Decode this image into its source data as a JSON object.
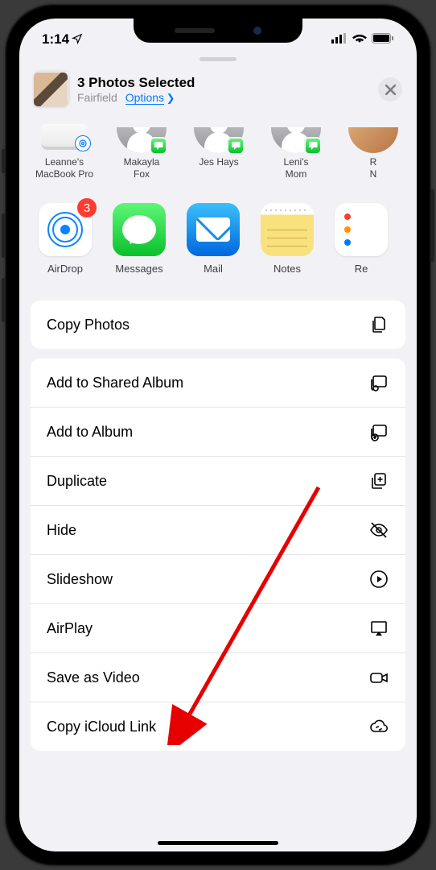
{
  "status": {
    "time": "1:14",
    "location_icon": "location-arrow"
  },
  "header": {
    "title": "3 Photos Selected",
    "location": "Fairfield",
    "options_label": "Options"
  },
  "contacts": [
    {
      "name": "Leanne's\nMacBook Pro",
      "type": "device",
      "badge": "airdrop"
    },
    {
      "name": "Makayla\nFox",
      "type": "person",
      "badge": "messages"
    },
    {
      "name": "Jes Hays",
      "type": "person",
      "badge": "messages"
    },
    {
      "name": "Leni's\nMom",
      "type": "person",
      "badge": "messages"
    },
    {
      "name": "R\nN",
      "type": "person",
      "badge": "none"
    }
  ],
  "apps": [
    {
      "name": "AirDrop",
      "badge": "3"
    },
    {
      "name": "Messages",
      "badge": null
    },
    {
      "name": "Mail",
      "badge": null
    },
    {
      "name": "Notes",
      "badge": null
    },
    {
      "name": "Re",
      "badge": null
    }
  ],
  "actions_primary": [
    {
      "label": "Copy Photos",
      "icon": "copy-docs"
    }
  ],
  "actions_secondary": [
    {
      "label": "Add to Shared Album",
      "icon": "shared-album"
    },
    {
      "label": "Add to Album",
      "icon": "add-album"
    },
    {
      "label": "Duplicate",
      "icon": "duplicate"
    },
    {
      "label": "Hide",
      "icon": "hide"
    },
    {
      "label": "Slideshow",
      "icon": "play-circle"
    },
    {
      "label": "AirPlay",
      "icon": "airplay"
    },
    {
      "label": "Save as Video",
      "icon": "video"
    },
    {
      "label": "Copy iCloud Link",
      "icon": "cloud-link"
    }
  ]
}
